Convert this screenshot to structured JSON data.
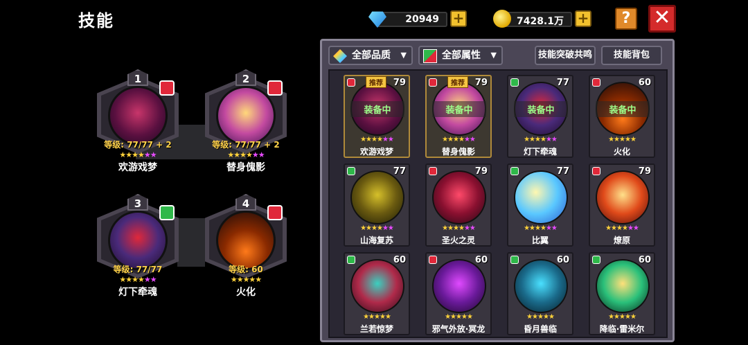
{
  "header": {
    "title": "技能"
  },
  "currency": {
    "gems": "20949",
    "gold": "7428.1万"
  },
  "buttons": {
    "help": "?",
    "close": "✕",
    "plus": "+"
  },
  "stars": {
    "five": "★★★★★",
    "six": "★★★★★★"
  },
  "equipped": [
    {
      "slot": "1",
      "level": "等级: 77/77 + 2",
      "name": "欢游戏梦",
      "element": "red",
      "pink_stars": 2
    },
    {
      "slot": "2",
      "level": "等级: 77/77 + 2",
      "name": "替身傀影",
      "element": "red",
      "pink_stars": 2
    },
    {
      "slot": "3",
      "level": "等级: 77/77",
      "name": "灯下牵魂",
      "element": "green",
      "pink_stars": 2
    },
    {
      "slot": "4",
      "level": "等级: 60",
      "name": "火化",
      "element": "red",
      "pink_stars": 0
    }
  ],
  "filters": {
    "quality": "全部品质",
    "attribute": "全部属性",
    "resonance": "技能突破共鸣",
    "bag": "技能背包"
  },
  "skills": [
    {
      "name": "欢游戏梦",
      "level": "79",
      "element": "red",
      "equipped": "装备中",
      "recommended": "推荐",
      "pink_stars": 2
    },
    {
      "name": "替身傀影",
      "level": "79",
      "element": "red",
      "equipped": "装备中",
      "recommended": "推荐",
      "pink_stars": 2
    },
    {
      "name": "灯下牵魂",
      "level": "77",
      "element": "green",
      "equipped": "装备中",
      "recommended": "",
      "pink_stars": 2
    },
    {
      "name": "火化",
      "level": "60",
      "element": "red",
      "equipped": "装备中",
      "recommended": "",
      "pink_stars": 0
    },
    {
      "name": "山海复苏",
      "level": "77",
      "element": "green",
      "equipped": "",
      "recommended": "",
      "pink_stars": 2
    },
    {
      "name": "圣火之灵",
      "level": "79",
      "element": "red",
      "equipped": "",
      "recommended": "",
      "pink_stars": 2
    },
    {
      "name": "比翼",
      "level": "77",
      "element": "green",
      "equipped": "",
      "recommended": "",
      "pink_stars": 2
    },
    {
      "name": "燎原",
      "level": "79",
      "element": "red",
      "equipped": "",
      "recommended": "",
      "pink_stars": 2
    },
    {
      "name": "兰若惊梦",
      "level": "60",
      "element": "green",
      "equipped": "",
      "recommended": "",
      "pink_stars": 0
    },
    {
      "name": "邪气外放·冥龙",
      "level": "60",
      "element": "red",
      "equipped": "",
      "recommended": "",
      "pink_stars": 0
    },
    {
      "name": "昏月兽临",
      "level": "60",
      "element": "green",
      "equipped": "",
      "recommended": "",
      "pink_stars": 0
    },
    {
      "name": "降临·雷米尔",
      "level": "60",
      "element": "green",
      "equipped": "",
      "recommended": "",
      "pink_stars": 0
    }
  ],
  "colors": {
    "accent_gold": "#f2c12e",
    "close_red": "#d42b2b",
    "equipped_green": "#9dff8a",
    "level_yellow": "#ffd24a"
  }
}
